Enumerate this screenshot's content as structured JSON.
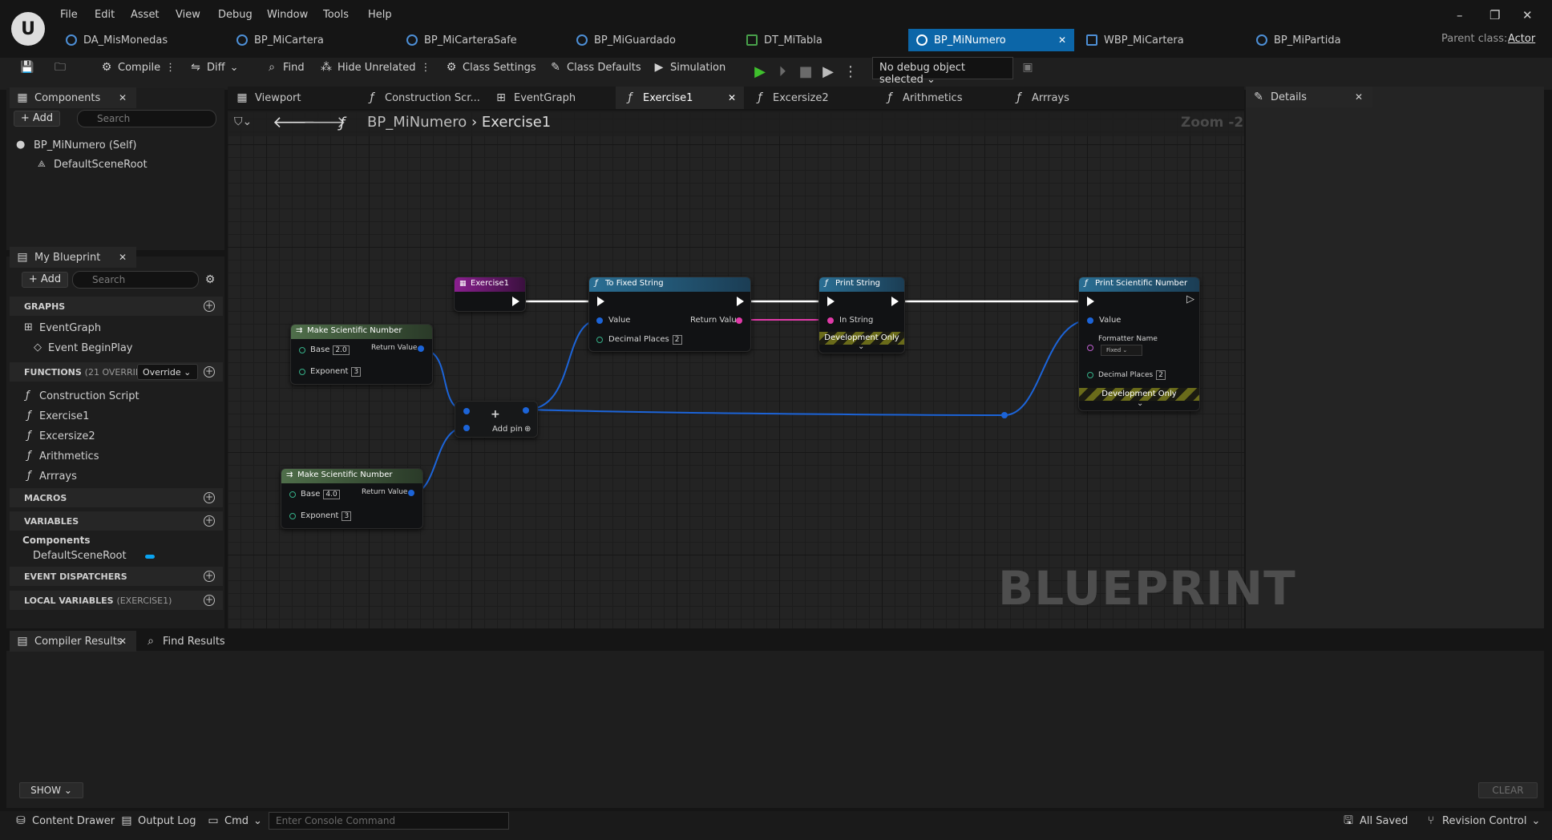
{
  "menu": [
    "File",
    "Edit",
    "Asset",
    "View",
    "Debug",
    "Window",
    "Tools",
    "Help"
  ],
  "tabs": [
    "DA_MisMonedas",
    "BP_MiCartera",
    "BP_MiCarteraSafe",
    "BP_MiGuardado",
    "DT_MiTabla",
    "BP_MiNumero",
    "WBP_MiCartera",
    "BP_MiPartida"
  ],
  "parent_class_label": "Parent class:",
  "parent_class_value": "Actor",
  "toolbar": {
    "compile": "Compile",
    "diff": "Diff",
    "find": "Find",
    "hide_unrelated": "Hide Unrelated",
    "class_settings": "Class Settings",
    "class_defaults": "Class Defaults",
    "simulation": "Simulation",
    "debug_object": "No debug object selected"
  },
  "components": {
    "title": "Components",
    "add": "Add",
    "search": "Search",
    "self": "BP_MiNumero (Self)",
    "root": "DefaultSceneRoot"
  },
  "my_blueprint": {
    "title": "My Blueprint",
    "add": "Add",
    "search": "Search",
    "graphs_label": "GRAPHS",
    "event_graph": "EventGraph",
    "event_beginplay": "Event BeginPlay",
    "functions_label": "FUNCTIONS",
    "functions_count": "(21 OVERRIDAB",
    "override": "Override",
    "functions": [
      "Construction Script",
      "Exercise1",
      "Excersize2",
      "Arithmetics",
      "Arrrays"
    ],
    "macros": "MACROS",
    "variables": "VARIABLES",
    "components_cat": "Components",
    "var_root": "DefaultSceneRoot",
    "event_dispatchers": "EVENT DISPATCHERS",
    "local_variables": "LOCAL VARIABLES",
    "local_scope": "(EXERCISE1)"
  },
  "graph_tabs": [
    "Viewport",
    "Construction Scr...",
    "EventGraph",
    "Exercise1",
    "Excersize2",
    "Arithmetics",
    "Arrrays"
  ],
  "details": "Details",
  "breadcrumb": {
    "blueprint": "BP_MiNumero",
    "function": "Exercise1",
    "zoom": "Zoom -2"
  },
  "watermark": "BLUEPRINT",
  "nodes": {
    "entry": {
      "title": "Exercise1"
    },
    "to_fixed": {
      "title": "To Fixed String",
      "value": "Value",
      "return": "Return Value",
      "decimal": "Decimal Places",
      "decimal_val": "2"
    },
    "print_string": {
      "title": "Print String",
      "in": "In String",
      "dev": "Development Only"
    },
    "print_sci": {
      "title": "Print Scientific Number",
      "value": "Value",
      "formatter": "Formatter Name",
      "formatter_val": "Fixed",
      "decimal": "Decimal Places",
      "decimal_val": "2",
      "dev": "Development Only"
    },
    "make1": {
      "title": "Make Scientific Number",
      "base": "Base",
      "base_val": "2.0",
      "exp": "Exponent",
      "exp_val": "3",
      "ret": "Return Value"
    },
    "make2": {
      "title": "Make Scientific Number",
      "base": "Base",
      "base_val": "4.0",
      "exp": "Exponent",
      "exp_val": "3",
      "ret": "Return Value"
    },
    "add": {
      "label": "Add pin"
    }
  },
  "bottom": {
    "compiler_results": "Compiler Results",
    "find_results": "Find Results",
    "show": "SHOW",
    "clear": "CLEAR"
  },
  "status": {
    "content_drawer": "Content Drawer",
    "output_log": "Output Log",
    "cmd": "Cmd",
    "console_placeholder": "Enter Console Command",
    "all_saved": "All Saved",
    "revision": "Revision Control"
  }
}
